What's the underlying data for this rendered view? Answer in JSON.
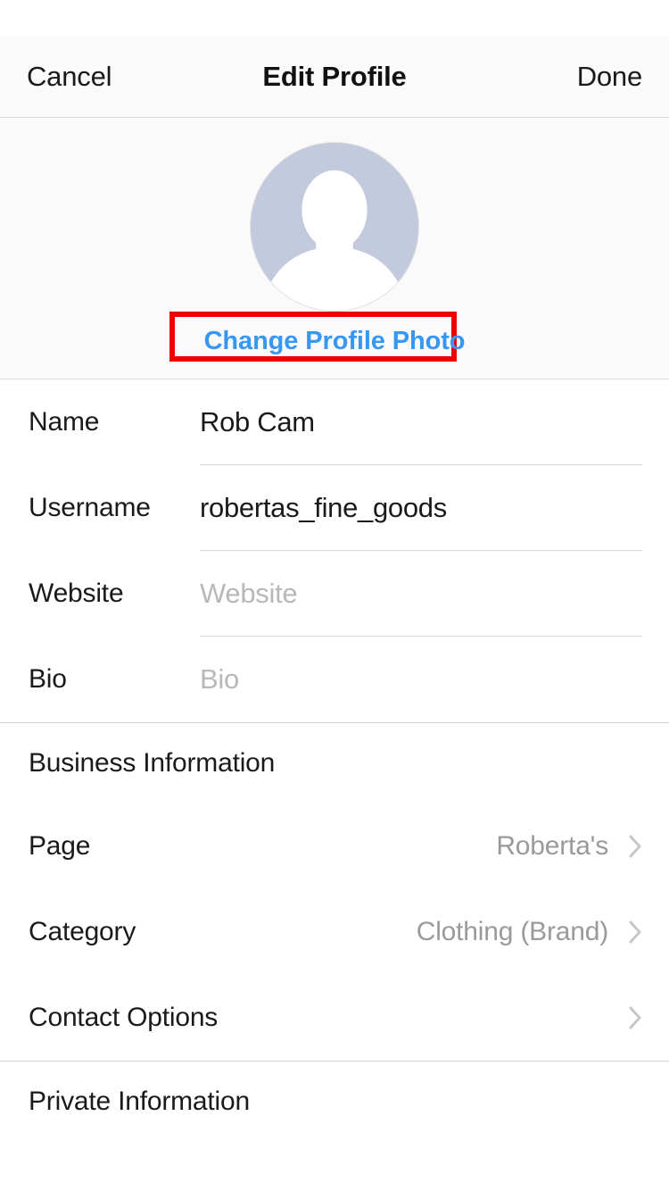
{
  "header": {
    "cancel_label": "Cancel",
    "title": "Edit Profile",
    "done_label": "Done"
  },
  "photo_section": {
    "avatar_alt": "default-profile-silhouette",
    "change_photo_label": "Change Profile Photo",
    "link_color": "#3897f0",
    "annotation_color": "#ee0000",
    "avatar_bg_color": "#c3cade"
  },
  "profile_fields": [
    {
      "label": "Name",
      "value": "Rob Cam",
      "placeholder": "Name",
      "is_placeholder": false,
      "underline": true
    },
    {
      "label": "Username",
      "value": "robertas_fine_goods",
      "placeholder": "Username",
      "is_placeholder": false,
      "underline": true
    },
    {
      "label": "Website",
      "value": "Website",
      "placeholder": "Website",
      "is_placeholder": true,
      "underline": true
    },
    {
      "label": "Bio",
      "value": "Bio",
      "placeholder": "Bio",
      "is_placeholder": true,
      "underline": false
    }
  ],
  "business_section": {
    "heading": "Business Information",
    "rows": [
      {
        "label": "Page",
        "value": "Roberta's",
        "chevron": "chevron-right-icon"
      },
      {
        "label": "Category",
        "value": "Clothing (Brand)",
        "chevron": "chevron-right-icon"
      },
      {
        "label": "Contact Options",
        "value": "",
        "chevron": "chevron-right-icon"
      }
    ]
  },
  "private_section": {
    "heading": "Private Information"
  }
}
